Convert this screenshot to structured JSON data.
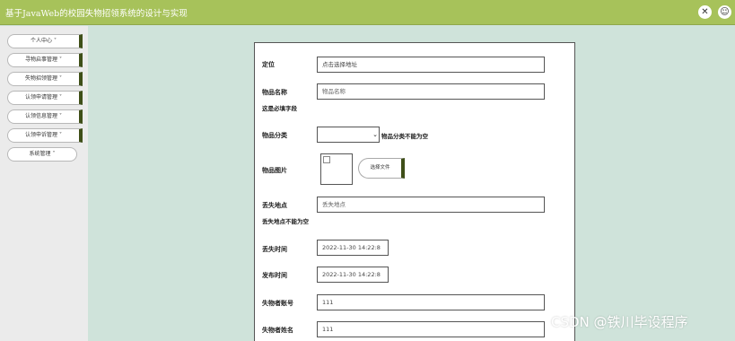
{
  "app": {
    "title": "基于JavaWeb的校园失物招领系统的设计与实现"
  },
  "topbar": {
    "icons": [
      "tools-icon",
      "user-icon"
    ]
  },
  "sidebar": {
    "items": [
      {
        "label": "个人中心 ˅"
      },
      {
        "label": "寻物启事管理 ˅"
      },
      {
        "label": "失物招领管理 ˅"
      },
      {
        "label": "认领申请管理 ˅"
      },
      {
        "label": "认领信息管理 ˅"
      },
      {
        "label": "认领申诉管理 ˅"
      },
      {
        "label": "系统管理 ˅"
      }
    ]
  },
  "form": {
    "location": {
      "label": "定位",
      "value": "点击选择地址"
    },
    "item_name": {
      "label": "物品名称",
      "placeholder": "物品名称",
      "hint": "这是必填字段"
    },
    "category": {
      "label": "物品分类",
      "value": "",
      "hint": "物品分类不能为空"
    },
    "image": {
      "label": "物品图片",
      "button": "选择文件"
    },
    "lost_place": {
      "label": "丢失地点",
      "placeholder": "丢失地点",
      "hint": "丢失地点不能为空"
    },
    "lost_time": {
      "label": "丢失时间",
      "value": "2022-11-30 14:22:8"
    },
    "publish_time": {
      "label": "发布时间",
      "value": "2022-11-30 14:22:8"
    },
    "owner_account": {
      "label": "失物者账号",
      "value": "111"
    },
    "owner_name": {
      "label": "失物者姓名",
      "value": "111"
    }
  },
  "watermark": {
    "text": "CSDN @铁川毕设程序"
  }
}
